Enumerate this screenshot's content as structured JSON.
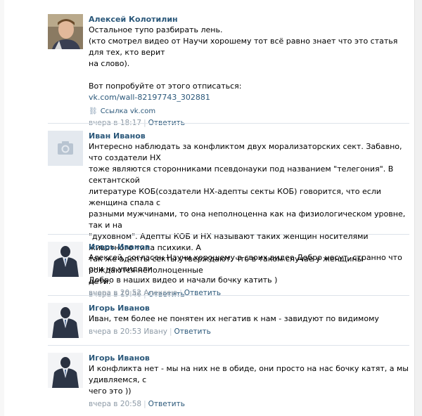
{
  "comments": [
    {
      "author": "Алексей Колотилин",
      "avatar": "user-photo",
      "lines": [
        "Остальное тупо разбирать лень.",
        "(кто смотрел видео от Научи хорошему тот всё равно знает что это статья для тех, кто верит",
        "на слово).",
        "",
        "Вот попробуйте от этого отписаться:"
      ],
      "link": "vk.com/wall-82197743_302881",
      "link_preview": "Ссылка vk.com",
      "time": "вчера в 18:17",
      "to": "",
      "reply": "Ответить"
    },
    {
      "author": "Иван Иванов",
      "avatar": "camera-placeholder",
      "lines": [
        "Интересно наблюдать за конфликтом двух морализаторских сект. Забавно, что создатели НХ",
        "тоже являются сторонниками псевдонауки под названием \"телегония\". В сектантской",
        "литературе КОБ(создатели НХ-адепты секты КОБ) говорится, что если женщина спала с",
        "разными мужчинами, то она неполноценна как на физиологическом уровне, так и на",
        "\"духовном\". Адепты КОБ и НХ называют таких женщин носителями животного типа психики. А",
        "так же адепты секты утверждают, что в таком случае у женщины рождаются неполноценные",
        "дети."
      ],
      "time": "вчера в 19:46",
      "to": "",
      "reply": "Ответить"
    },
    {
      "author": "Игорь Иванов",
      "avatar": "suit-man",
      "lines": [
        "Алексей, согласен Научи хорошему в своих видео Добро несут, странно что они не увидели",
        "Добро в наших видео и начали бочку катить )"
      ],
      "time": "вчера в 20:52",
      "to": "Алексею",
      "reply": "Ответить"
    },
    {
      "author": "Игорь Иванов",
      "avatar": "suit-man",
      "lines": [
        "Иван, тем более не понятен их негатив к нам - завидуют по видимому"
      ],
      "time": "вчера в 20:53",
      "to": "Ивану",
      "reply": "Ответить"
    },
    {
      "author": "Игорь Иванов",
      "avatar": "suit-man",
      "lines": [
        "И конфликта нет - мы на них не в обиде, они просто на нас бочку катят, а мы удивляемся, с",
        "чего это ))"
      ],
      "time": "вчера в 20:58",
      "to": "",
      "reply": "Ответить"
    }
  ]
}
